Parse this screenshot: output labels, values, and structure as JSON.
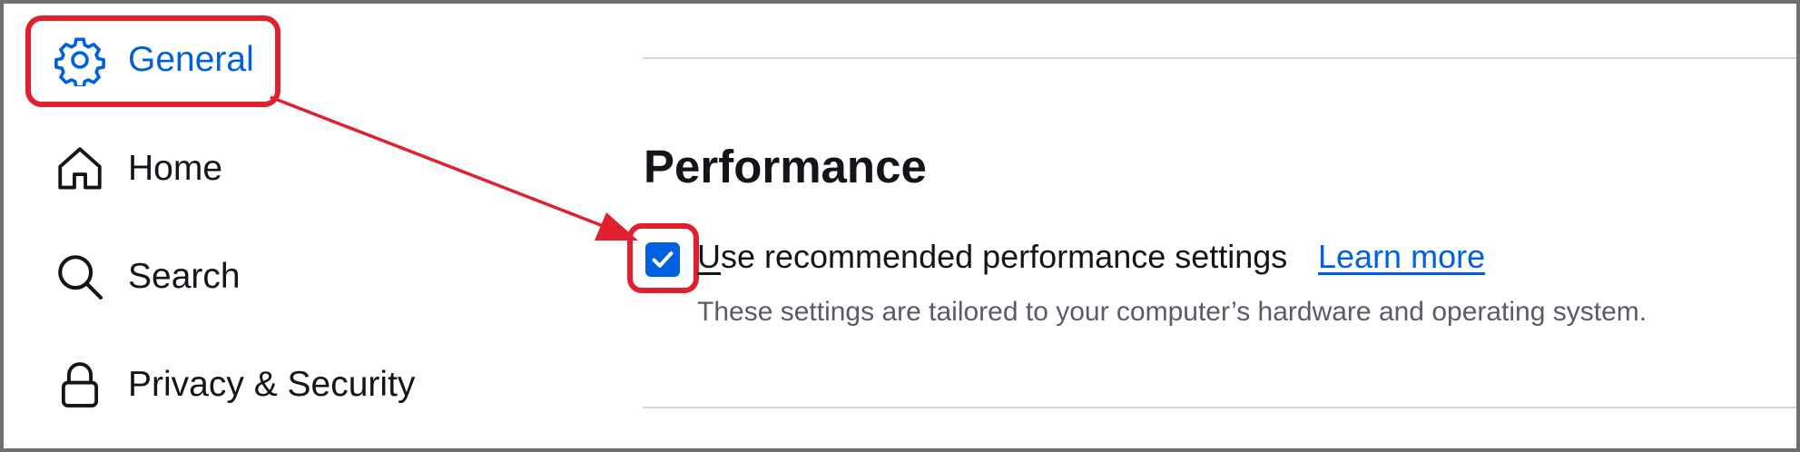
{
  "sidebar": {
    "items": [
      {
        "label": "General",
        "icon": "gear-icon",
        "selected": true
      },
      {
        "label": "Home",
        "icon": "home-icon",
        "selected": false
      },
      {
        "label": "Search",
        "icon": "search-icon",
        "selected": false
      },
      {
        "label": "Privacy & Security",
        "icon": "lock-icon",
        "selected": false
      }
    ]
  },
  "main": {
    "section_title": "Performance",
    "checkbox": {
      "accesskey_char": "U",
      "label_rest": "se recommended performance settings",
      "checked": true
    },
    "learn_more": "Learn more",
    "description": "These settings are tailored to your computer’s hardware and operating system."
  },
  "colors": {
    "accent": "#0061e0",
    "annotation_red": "#e0202e",
    "text": "#15141a",
    "muted_text": "#5b5b66",
    "divider": "#d6d6d9",
    "frame": "#6f6f6f"
  }
}
